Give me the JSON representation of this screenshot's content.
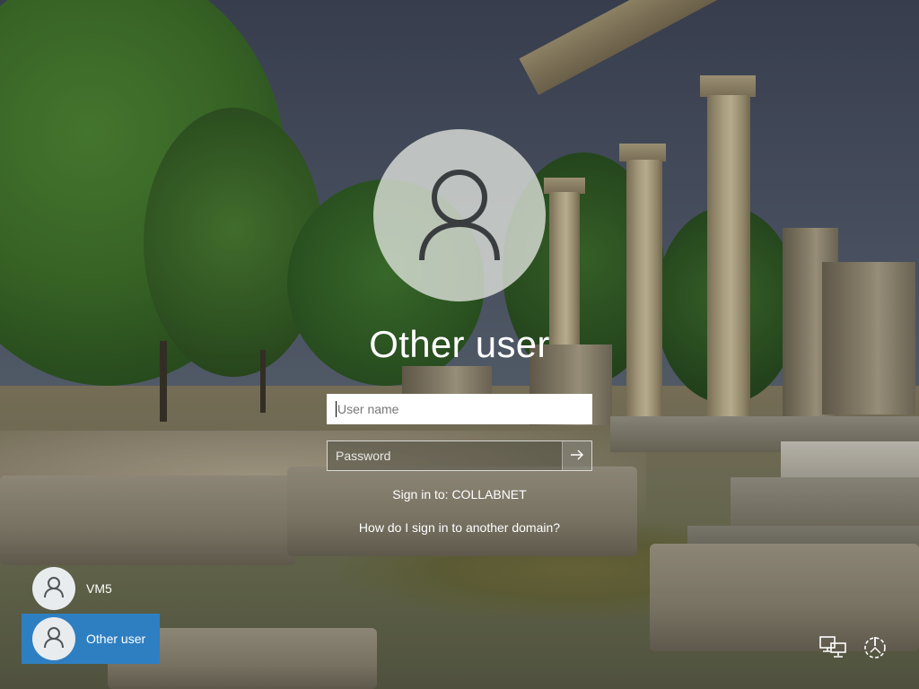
{
  "user": {
    "display_name": "Other user"
  },
  "fields": {
    "username_placeholder": "User name",
    "username_value": "",
    "password_placeholder": "Password",
    "password_value": ""
  },
  "sign_in_to": "Sign in to: COLLABNET",
  "domain_help_link": "How do I sign in to another domain?",
  "user_list": [
    {
      "label": "VM5",
      "selected": false
    },
    {
      "label": "Other user",
      "selected": true
    }
  ],
  "icons": {
    "avatar": "user-silhouette-icon",
    "submit": "arrow-right-icon",
    "network": "network-icon",
    "power": "power-icon"
  },
  "colors": {
    "selected_tile": "#2e7fc2",
    "text": "#ffffff"
  }
}
